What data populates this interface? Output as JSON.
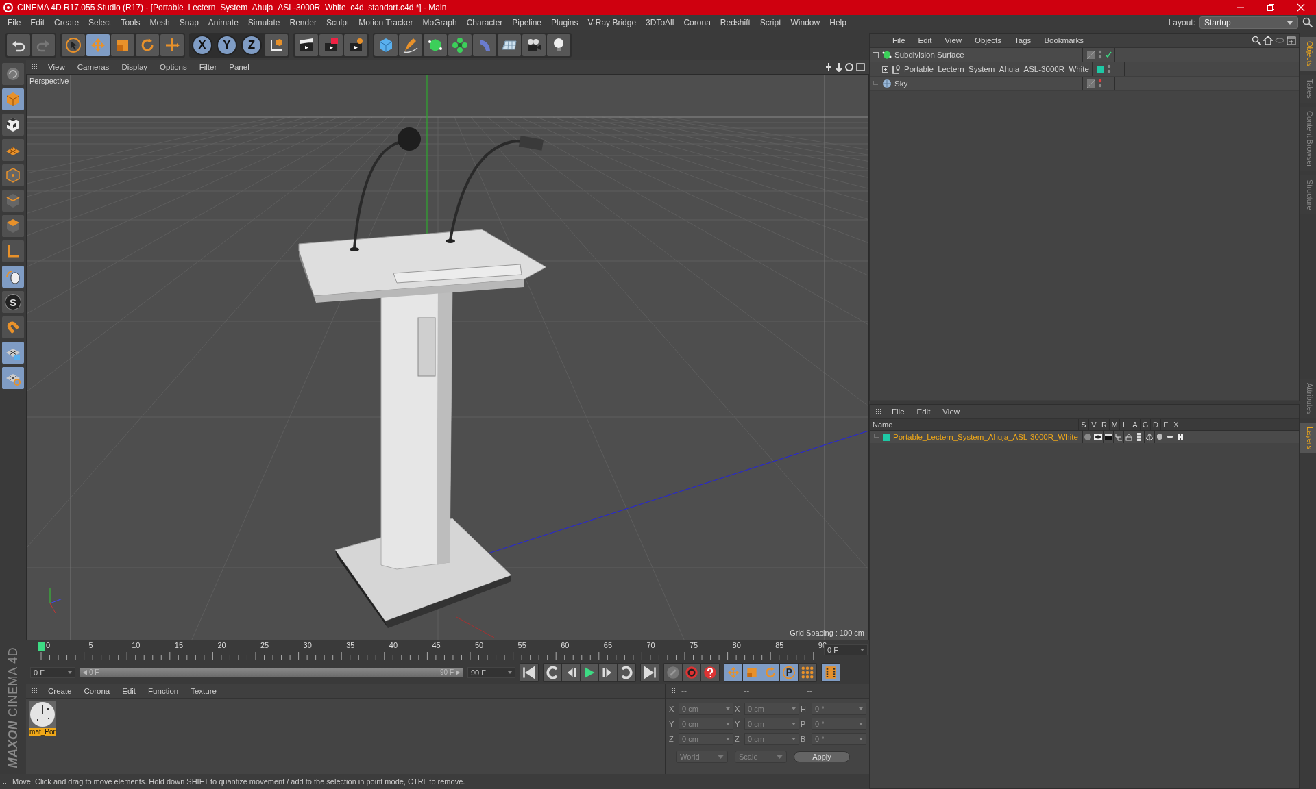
{
  "title": "CINEMA 4D R17.055 Studio (R17) - [Portable_Lectern_System_Ahuja_ASL-3000R_White_c4d_standart.c4d *] - Main",
  "menu_bar": [
    "File",
    "Edit",
    "Create",
    "Select",
    "Tools",
    "Mesh",
    "Snap",
    "Animate",
    "Simulate",
    "Render",
    "Sculpt",
    "Motion Tracker",
    "MoGraph",
    "Character",
    "Pipeline",
    "Plugins",
    "V-Ray Bridge",
    "3DToAll",
    "Corona",
    "Redshift",
    "Script",
    "Window",
    "Help"
  ],
  "layout": {
    "label": "Layout:",
    "value": "Startup"
  },
  "axis_buttons": [
    "X",
    "Y",
    "Z"
  ],
  "sculpt_label": "S",
  "logo": {
    "brand": "MAXON",
    "product": "CINEMA 4D"
  },
  "viewport": {
    "menu": [
      "View",
      "Cameras",
      "Display",
      "Options",
      "Filter",
      "Panel"
    ],
    "camera_label": "Perspective",
    "grid_spacing": "Grid Spacing : 100 cm"
  },
  "timeline": {
    "ticks": [
      "0",
      "5",
      "10",
      "15",
      "20",
      "25",
      "30",
      "35",
      "40",
      "45",
      "50",
      "55",
      "60",
      "65",
      "70",
      "75",
      "80",
      "85",
      "90"
    ],
    "current_frame": "0 F",
    "start_field": "0 F",
    "range": {
      "start": "0 F",
      "end": "90 F",
      "level": 1
    },
    "end_field": "90 F"
  },
  "material_manager": {
    "menu": [
      "Create",
      "Corona",
      "Edit",
      "Function",
      "Texture"
    ],
    "materials": [
      {
        "name": "mat_Por",
        "selected": true
      }
    ]
  },
  "coordinates": {
    "disabled": true,
    "headers": [
      "--",
      "--",
      "--"
    ],
    "rows": [
      [
        {
          "axis": "X",
          "value": "0 cm"
        },
        {
          "axis": "X",
          "value": "0 cm"
        },
        {
          "axis": "H",
          "value": "0 °"
        }
      ],
      [
        {
          "axis": "Y",
          "value": "0 cm"
        },
        {
          "axis": "Y",
          "value": "0 cm"
        },
        {
          "axis": "P",
          "value": "0 °"
        }
      ],
      [
        {
          "axis": "Z",
          "value": "0 cm"
        },
        {
          "axis": "Z",
          "value": "0 cm"
        },
        {
          "axis": "B",
          "value": "0 °"
        }
      ]
    ],
    "dropdowns": [
      "World",
      "Scale"
    ],
    "apply": "Apply"
  },
  "status_bar": "Move: Click and drag to move elements. Hold down SHIFT to quantize movement / add to the selection in point mode, CTRL to remove.",
  "object_manager": {
    "menu": [
      "File",
      "Edit",
      "View",
      "Objects",
      "Tags",
      "Bookmarks"
    ],
    "objects": [
      {
        "name": "Subdivision Surface",
        "kind": "generator",
        "expanded": true,
        "render_visible": true,
        "children": [
          {
            "name": "Portable_Lectern_System_Ahuja_ASL-3000R_White",
            "kind": "null",
            "expanded": false,
            "render_visible": true,
            "color": "#1ec8a5"
          }
        ]
      },
      {
        "name": "Sky",
        "kind": "sky",
        "render_visible": false
      }
    ]
  },
  "layer_manager": {
    "menu": [
      "File",
      "Edit",
      "View"
    ],
    "name_column": "Name",
    "flag_columns": [
      "S",
      "V",
      "R",
      "M",
      "L",
      "A",
      "G",
      "D",
      "E",
      "X"
    ],
    "layers": [
      {
        "name": "Portable_Lectern_System_Ahuja_ASL-3000R_White",
        "color": "#1ec8a5"
      }
    ]
  },
  "side_tabs_top": [
    {
      "label": "Objects",
      "selected": true
    },
    {
      "label": "Takes",
      "selected": false
    },
    {
      "label": "Content Browser",
      "selected": false
    },
    {
      "label": "Structure",
      "selected": false
    }
  ],
  "side_tabs_bottom": [
    {
      "label": "Attributes",
      "selected": false
    },
    {
      "label": "Layers",
      "selected": true
    }
  ]
}
